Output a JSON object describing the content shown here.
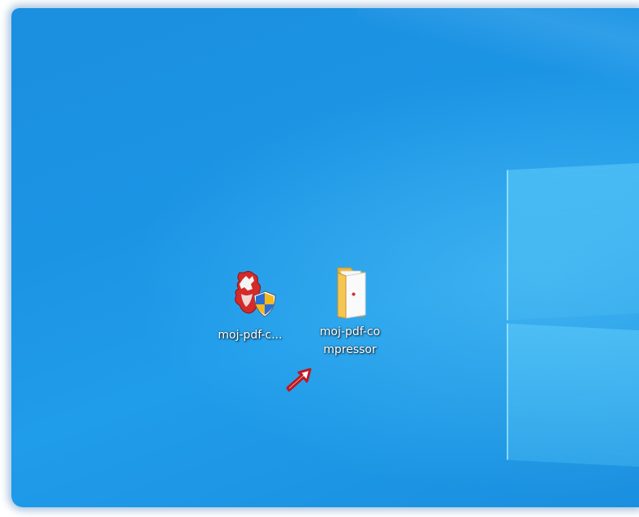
{
  "desktop": {
    "icons": [
      {
        "label": "moj-pdf-c...",
        "icon": "installer-shield-icon"
      },
      {
        "label": "moj-pdf-co\nmpressor",
        "icon": "folder-icon"
      }
    ]
  },
  "annotation": {
    "icon": "pointer-arrow-icon",
    "color": "#c0181f"
  },
  "colors": {
    "desktop_blue": "#1b8fe0",
    "folder_yellow": "#f3c752",
    "shield_blue": "#2a6fd6",
    "shield_yellow": "#f5b81e"
  }
}
